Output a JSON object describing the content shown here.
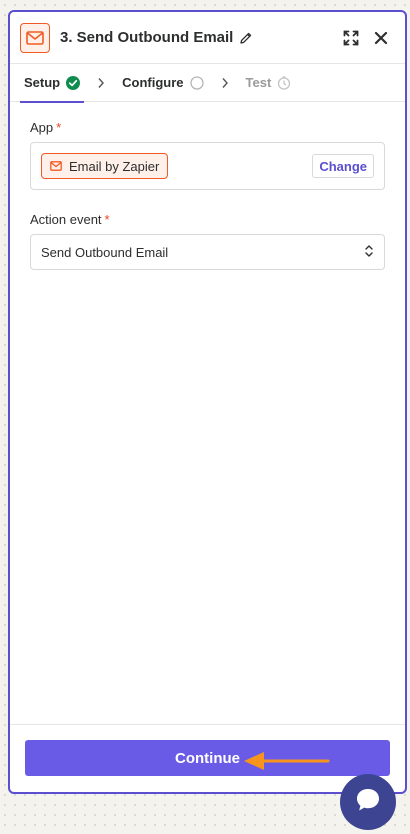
{
  "header": {
    "step_title": "3. Send Outbound Email",
    "app_icon": "envelope-icon",
    "edit_icon": "pencil-icon",
    "expand_icon": "expand-icon",
    "close_icon": "close-icon"
  },
  "tabs": [
    {
      "label": "Setup",
      "status": "complete"
    },
    {
      "label": "Configure",
      "status": "pending"
    },
    {
      "label": "Test",
      "status": "disabled"
    }
  ],
  "app_field": {
    "label": "App",
    "required_mark": "*",
    "app_name": "Email by Zapier",
    "change_label": "Change"
  },
  "action_field": {
    "label": "Action event",
    "required_mark": "*",
    "value": "Send Outbound Email"
  },
  "footer": {
    "continue_label": "Continue"
  },
  "colors": {
    "accent": "#6a5be6",
    "panel_border": "#5a4fcf",
    "app_orange": "#f15a24",
    "success_green": "#118c4f",
    "annotation_arrow": "#f7941d",
    "chat_bubble": "#3d4592"
  }
}
